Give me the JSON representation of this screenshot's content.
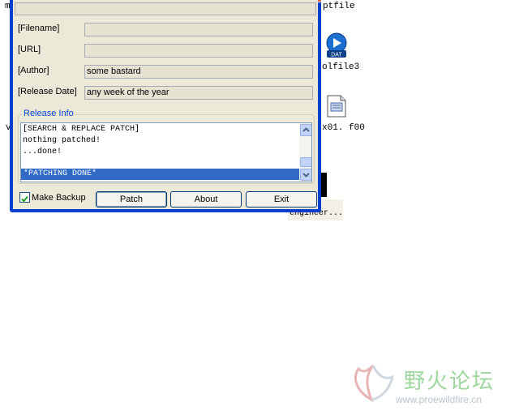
{
  "desktop": {
    "items": [
      {
        "label": "m"
      },
      {
        "label": "ptfile"
      },
      {
        "label": "olfile3"
      },
      {
        "label": "x01. f00"
      },
      {
        "label": "v"
      },
      {
        "label": "ro\nengineer..."
      }
    ],
    "dat_icon_text": "DAT"
  },
  "window": {
    "fields": [
      {
        "label": "[Filename]",
        "value": ""
      },
      {
        "label": "[URL]",
        "value": ""
      },
      {
        "label": "[Author]",
        "value": "some bastard"
      },
      {
        "label": "[Release Date]",
        "value": "any week of the year"
      }
    ],
    "release_group": {
      "title": "Release Info",
      "log_lines": [
        "[SEARCH & REPLACE PATCH]",
        "nothing patched!",
        "...done!",
        ""
      ],
      "selected_line": "*PATCHING DONE*"
    },
    "make_backup": {
      "label": "Make Backup",
      "checked": true
    },
    "buttons": {
      "patch": "Patch",
      "about": "About",
      "exit": "Exit"
    }
  },
  "watermark": {
    "chinese": "野火论坛",
    "url": "www.proewildfire.cn"
  }
}
